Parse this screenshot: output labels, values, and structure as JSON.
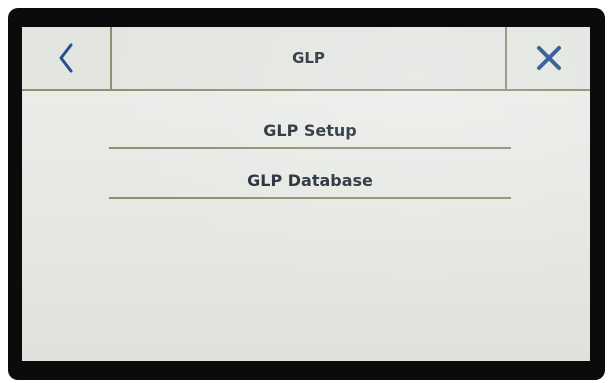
{
  "header": {
    "title": "GLP",
    "back_icon": "chevron-left-icon",
    "close_icon": "close-icon"
  },
  "menu": {
    "items": [
      {
        "label": "GLP Setup"
      },
      {
        "label": "GLP Database"
      }
    ]
  },
  "colors": {
    "bezel": "#0b0b0b",
    "screen": "#e6e8e4",
    "divider": "#8d8f6f",
    "icon": "#24508f",
    "text": "#1f2a33"
  }
}
